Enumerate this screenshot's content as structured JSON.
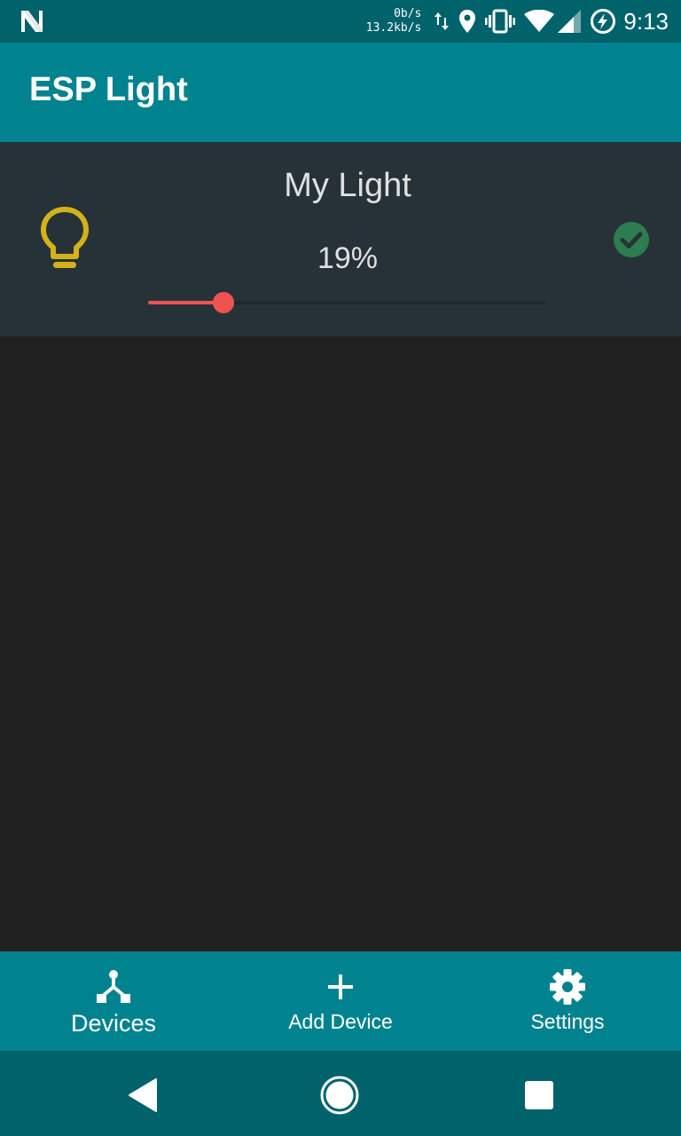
{
  "status_bar": {
    "net_speed_up": "0b/s",
    "net_speed_down": "13.2kb/s",
    "time": "9:13",
    "icons": [
      "notification-n-icon",
      "data-transfer-icon",
      "location-icon",
      "vibrate-icon",
      "wifi-icon",
      "cell-signal-icon",
      "battery-charging-icon"
    ]
  },
  "app_bar": {
    "title": "ESP Light"
  },
  "device": {
    "name": "My Light",
    "level_text": "19%",
    "level": 0.19,
    "icon": "lightbulb-icon",
    "status_icon": "check-circle-icon"
  },
  "bottom_nav": {
    "items": [
      {
        "label": "Devices",
        "icon": "devices-icon",
        "active": true
      },
      {
        "label": "Add Device",
        "icon": "plus-icon",
        "active": false
      },
      {
        "label": "Settings",
        "icon": "gear-icon",
        "active": false
      }
    ]
  },
  "colors": {
    "status_bar": "#00626B",
    "app_bar": "#00838F",
    "background": "#212121",
    "card": "#263238",
    "bulb": "#D4B21A",
    "slider": "#EF5350",
    "check": "#2E7D4F"
  }
}
